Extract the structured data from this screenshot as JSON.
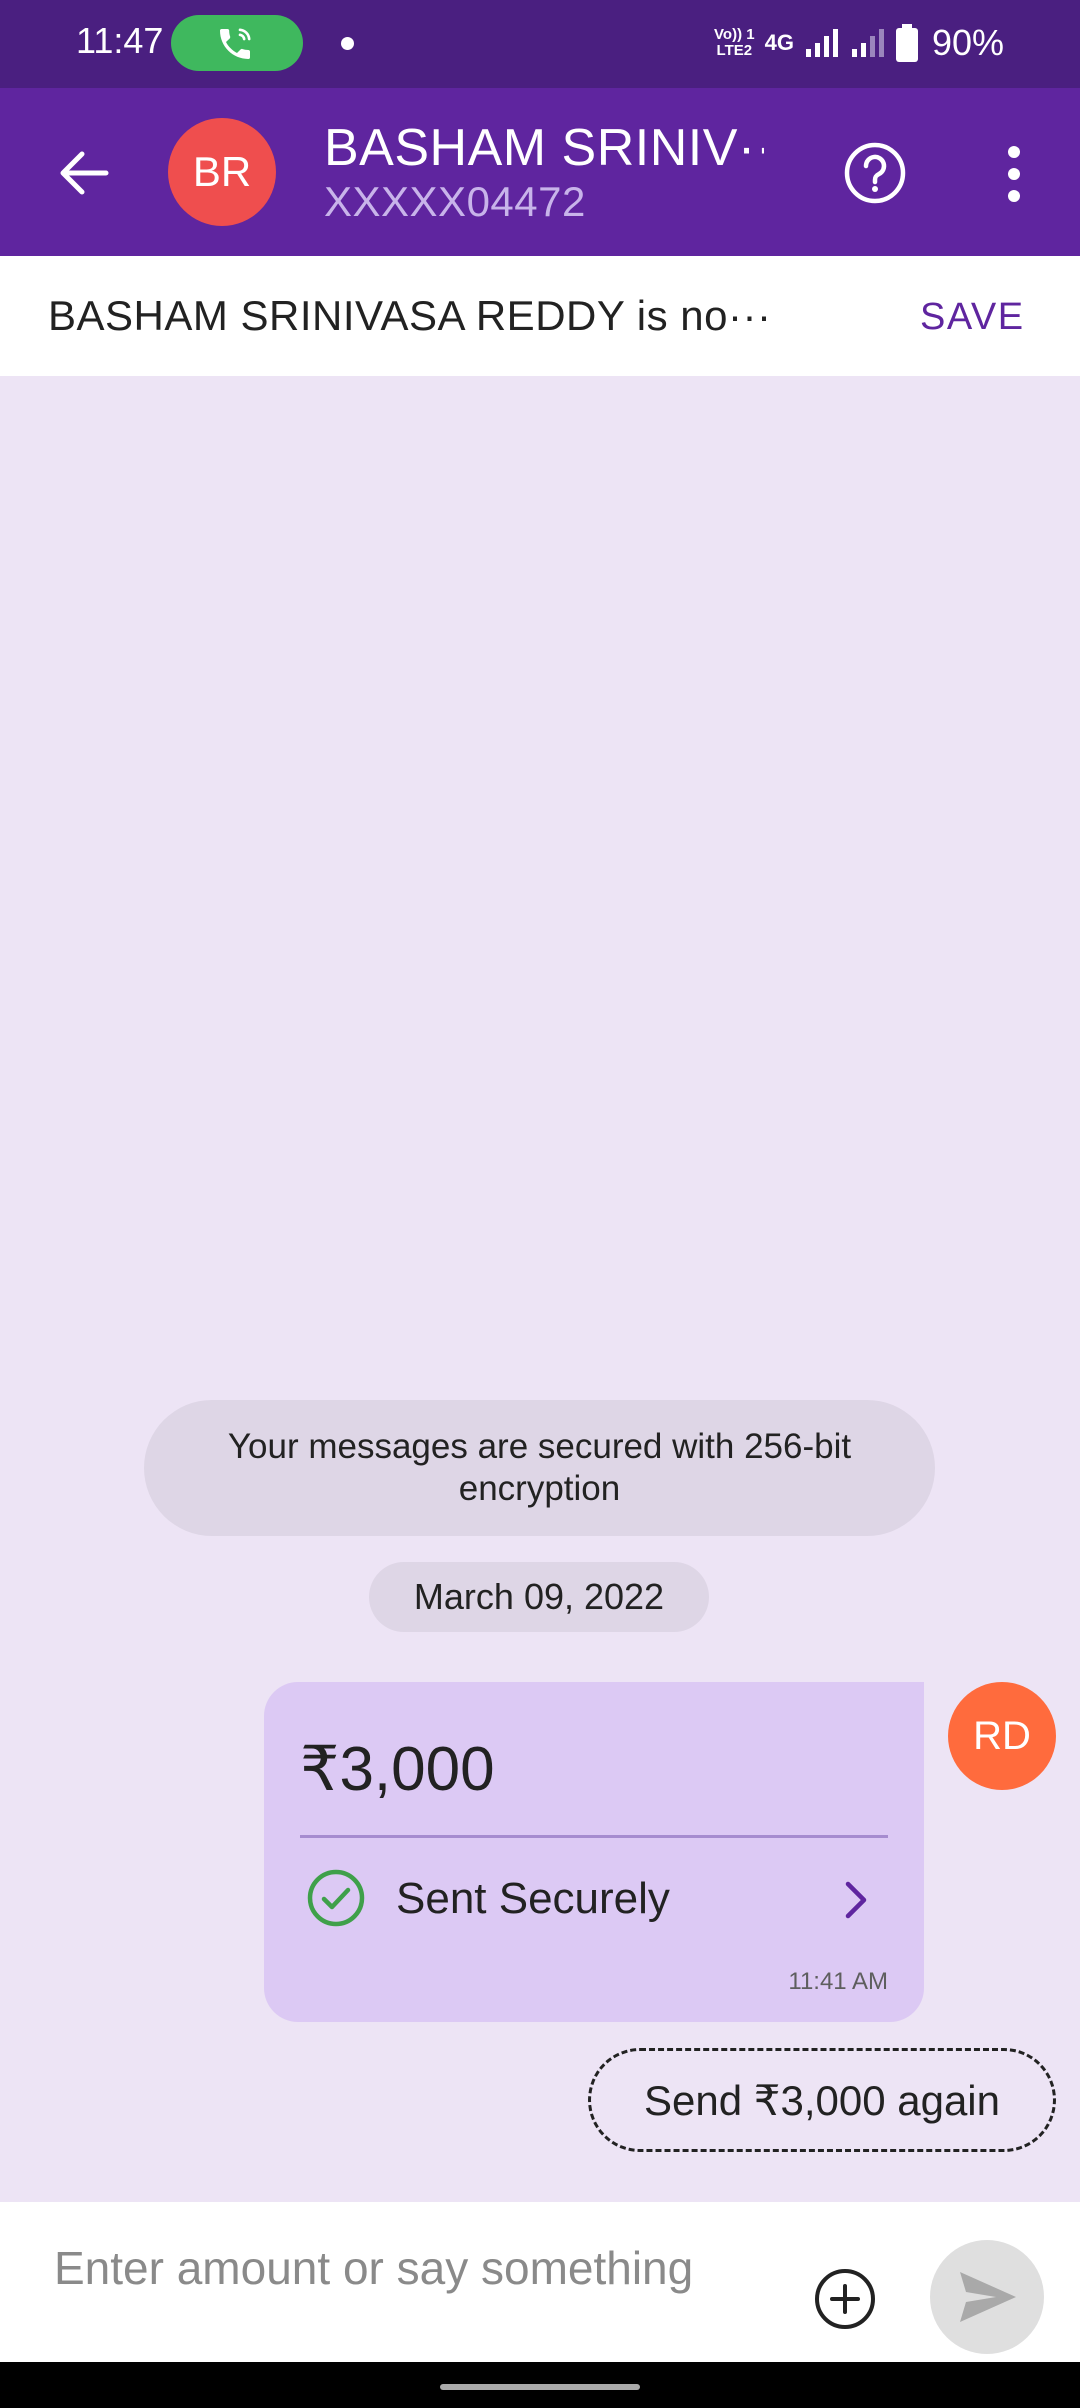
{
  "status_bar": {
    "time": "11:47",
    "volte_line1": "Vo)) 1",
    "volte_line2": "LTE2",
    "network": "4G",
    "battery": "90%"
  },
  "header": {
    "avatar_initials": "BR",
    "contact_name": "BASHAM  SRINIV···",
    "contact_number": "XXXXX04472"
  },
  "save_banner": {
    "text": "BASHAM  SRINIVASA REDDY is no···",
    "button_label": "SAVE"
  },
  "chat": {
    "encryption_note": "Your messages are secured with 256-bit encryption",
    "date_label": "March 09, 2022",
    "payment": {
      "amount": "₹3,000",
      "status": "Sent Securely",
      "time": "11:41 AM"
    },
    "sender_initials": "RD",
    "send_again_label": "Send ₹3,000 again"
  },
  "input": {
    "placeholder": "Enter amount or say something"
  },
  "colors": {
    "primary": "#5f259f",
    "status_bar": "#4a1f80",
    "chat_background": "#ede4f5",
    "bubble": "#dcc9f4",
    "success": "#3fa04a"
  }
}
